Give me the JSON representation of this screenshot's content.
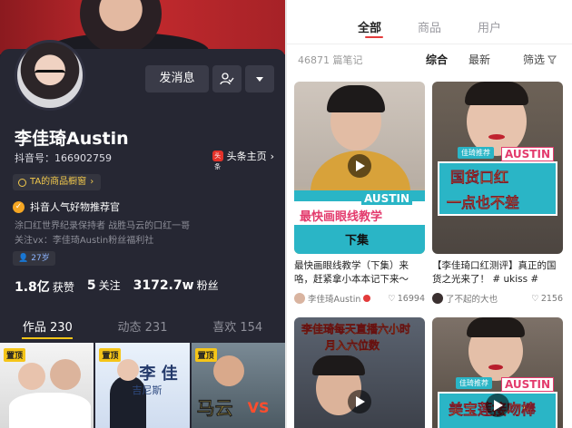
{
  "profile": {
    "name": "李佳琦Austin",
    "douyin_id": "抖音号：166902759",
    "message_button": "发消息",
    "toutiao_link": "头条主页",
    "toutiao_logo": "头条",
    "product_window": "TA的商品橱窗",
    "badge_text": "抖音人气好物推荐官",
    "bio_line1": "涂口红世界纪录保持者 战胜马云的口红一哥",
    "bio_line2": "关注vx：李佳琦Austin粉丝福利社",
    "age": "27岁",
    "stats": [
      {
        "value": "1.8亿",
        "label": "获赞"
      },
      {
        "value": "5",
        "label": "关注"
      },
      {
        "value": "3172.7w",
        "label": "粉丝"
      }
    ],
    "tabs": [
      {
        "label": "作品 230",
        "active": true
      },
      {
        "label": "动态 231",
        "active": false
      },
      {
        "label": "喜欢 154",
        "active": false
      }
    ],
    "thumbs": [
      {
        "pin": "置顶"
      },
      {
        "pin": "置顶",
        "overlay": "李 佳",
        "sub": "吉尼斯"
      },
      {
        "pin": "置顶",
        "overlay": "马云",
        "vs": "VS"
      }
    ]
  },
  "search": {
    "tabs": [
      {
        "label": "全部",
        "active": true
      },
      {
        "label": "商品",
        "active": false
      },
      {
        "label": "用户",
        "active": false
      }
    ],
    "count": "46871 篇笔记",
    "sort_options": [
      "综合",
      "最新"
    ],
    "filter_label": "筛选",
    "cards": [
      {
        "overlay_tag": "AUSTIN",
        "overlay_line1": "最快画眼线教学",
        "overlay_line2": "下集",
        "title": "最快画眼线教学（下集）来咯，赶紧拿小本本记下来～",
        "author": "李佳琦Austin",
        "likes": "16994"
      },
      {
        "overlay_rec": "佳琦推荐",
        "overlay_tag": "AUSTIN",
        "overlay_line1": "国货口红",
        "overlay_line2": "一点也不差",
        "title": "【李佳琦口红测评】真正的国货之光来了！ # ukiss #",
        "author": "了不起的大也",
        "likes": "2156"
      },
      {
        "overlay_line1": "李佳琦每天直播六小时",
        "overlay_line2": "月入六位数"
      },
      {
        "overlay_rec": "佳琦推荐",
        "overlay_tag": "AUSTIN",
        "overlay_line1": "美宝莲接吻棒"
      }
    ]
  },
  "colors": {
    "accent_red": "#e33b3b",
    "profile_bg": "#262733",
    "gold": "#f5c518",
    "teal": "#2ab5c6"
  }
}
